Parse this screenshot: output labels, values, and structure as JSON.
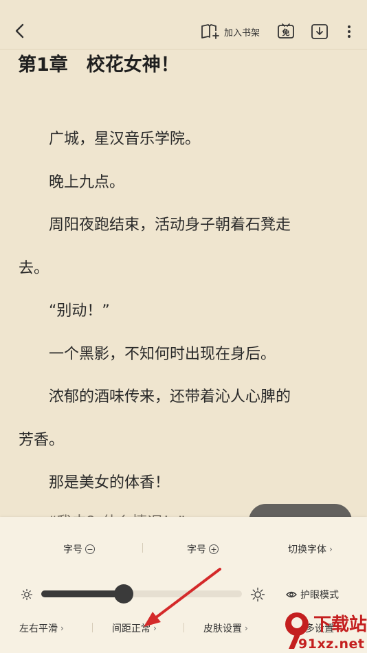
{
  "topbar": {
    "add_shelf_label": "加入书架",
    "free_icon_text": "免",
    "icons": [
      "back-icon",
      "add-bookshelf-icon",
      "free-icon",
      "download-icon",
      "more-icon"
    ]
  },
  "reader": {
    "chapter_title": "第1章　校花女神！",
    "paragraphs": [
      "　　广城，星汉音乐学院。",
      "　　晚上九点。",
      "　　周阳夜跑结束，活动身子朝着石凳走",
      "去。",
      "　　“别动！”",
      "　　一个黑影，不知何时出现在身后。",
      "　　浓郁的酒味传来，还带着沁人心脾的",
      "芳香。",
      "　　那是美女的体香！",
      "　　“我去？什么情况！”"
    ]
  },
  "settings_panel": {
    "font_size_minus_label": "字号",
    "font_size_plus_label": "字号",
    "switch_font_label": "切换字体",
    "eye_mode_label": "护眼模式",
    "brightness_level": 0.41,
    "page_turn_label": "左右平滑",
    "spacing_label": "间距正常",
    "skin_label": "皮肤设置",
    "more_settings_label": "更多设置"
  },
  "watermark": {
    "site_name": "下载站",
    "site_url": "91xz.net",
    "logo_text": "91"
  },
  "colors": {
    "page_bg": "#efe5cf",
    "panel_bg": "#f7f1e3",
    "slider_fill": "#3a3a3a",
    "annotation_arrow": "#d42a2a",
    "watermark_red": "#c41f1f"
  }
}
